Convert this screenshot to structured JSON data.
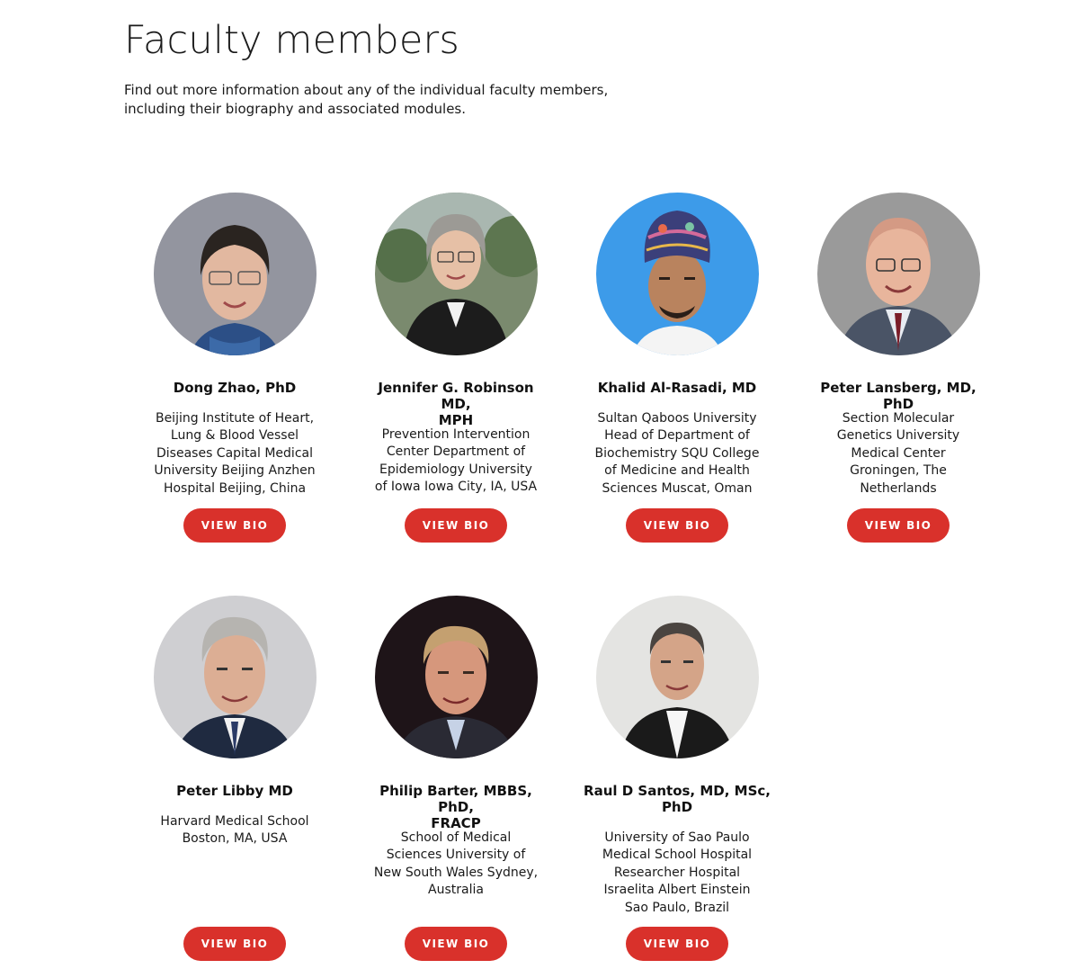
{
  "header": {
    "title": "Faculty members",
    "intro_line1": "Find out more information about any of the individual faculty members,",
    "intro_line2": "including their biography and associated modules."
  },
  "faculty": [
    {
      "name": "Dong Zhao, PhD",
      "affiliation_lines": [
        "Beijing Institute of Heart,",
        "Lung & Blood Vessel",
        "Diseases Capital Medical",
        "University Beijing Anzhen",
        "Hospital Beijing, China"
      ],
      "button": "VIEW BIO",
      "photo_bg": "#8d8f99"
    },
    {
      "name_lines": [
        "Jennifer G. Robinson MD,",
        "MPH"
      ],
      "affiliation_lines": [
        "Prevention Intervention",
        "Center Department of",
        "Epidemiology University",
        "of Iowa Iowa City, IA, USA"
      ],
      "button": "VIEW BIO",
      "photo_bg": "#7a8a6e"
    },
    {
      "name": "Khalid Al-Rasadi, MD",
      "affiliation_lines": [
        "Sultan Qaboos University",
        "Head of Department of",
        "Biochemistry SQU College",
        "of Medicine and Health",
        "Sciences Muscat, Oman"
      ],
      "button": "VIEW BIO",
      "photo_bg": "#3d9be9"
    },
    {
      "name": "Peter Lansberg, MD, PhD",
      "affiliation_lines": [
        "Section Molecular",
        "Genetics University",
        "Medical Center",
        "Groningen, The",
        "Netherlands"
      ],
      "button": "VIEW BIO",
      "photo_bg": "#9a9a9a"
    },
    {
      "name": "Peter Libby MD",
      "affiliation_lines": [
        "Harvard Medical School",
        "Boston, MA, USA"
      ],
      "button": "VIEW BIO",
      "photo_bg": "#cfcfd2"
    },
    {
      "name_lines": [
        "Philip Barter, MBBS, PhD,",
        "FRACP"
      ],
      "affiliation_lines": [
        "School of Medical",
        "Sciences University of",
        "New South Wales Sydney,",
        "Australia"
      ],
      "button": "VIEW BIO",
      "photo_bg": "#1e1418"
    },
    {
      "name_lines": [
        "Raul D Santos, MD, MSc,",
        "PhD"
      ],
      "affiliation_lines": [
        "University of Sao Paulo",
        "Medical School Hospital",
        "Researcher Hospital",
        "Israelita Albert Einstein",
        "Sao Paulo, Brazil"
      ],
      "button": "VIEW BIO",
      "photo_bg": "#e4e4e2"
    }
  ],
  "colors": {
    "accent": "#d9312b",
    "text": "#1a1a1a"
  }
}
